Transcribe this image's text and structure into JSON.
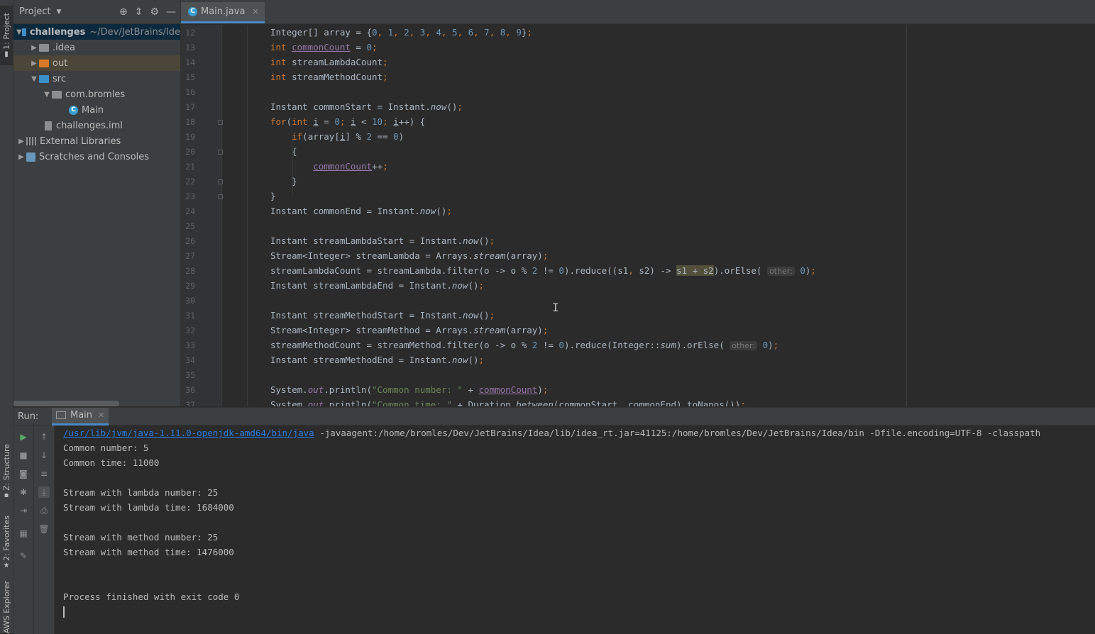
{
  "left_strip": {
    "project_tab": "1: Project",
    "structure_tab": "Z: Structure",
    "favorites_tab": "2: Favorites",
    "aws_tab": "AWS Explorer"
  },
  "project_panel": {
    "title": "Project",
    "tree": [
      {
        "label": "challenges",
        "path": "~/Dev/JetBrains/Ide"
      },
      {
        "label": ".idea"
      },
      {
        "label": "out"
      },
      {
        "label": "src"
      },
      {
        "label": "com.bromles"
      },
      {
        "label": "Main"
      },
      {
        "label": "challenges.iml"
      },
      {
        "label": "External Libraries"
      },
      {
        "label": "Scratches and Consoles"
      }
    ]
  },
  "editor": {
    "tab": "Main.java",
    "line_numbers": [
      "12",
      "13",
      "14",
      "15",
      "16",
      "17",
      "18",
      "19",
      "20",
      "21",
      "22",
      "23",
      "24",
      "25",
      "26",
      "27",
      "28",
      "29",
      "30",
      "31",
      "32",
      "33",
      "34",
      "35",
      "36",
      "37"
    ],
    "hint_other": "other:"
  },
  "run_panel": {
    "label": "Run:",
    "tab": "Main",
    "command_link": "/usr/lib/jvm/java-1.11.0-openjdk-amd64/bin/java",
    "command_args": " -javaagent:/home/bromles/Dev/JetBrains/Idea/lib/idea_rt.jar=41125:/home/bromles/Dev/JetBrains/Idea/bin -Dfile.encoding=UTF-8 -classpath",
    "output": [
      "Common number: 5",
      "Common time: 11000",
      "",
      "Stream with lambda number: 25",
      "Stream with lambda time: 1684000",
      "",
      "Stream with method number: 25",
      "Stream with method time: 1476000",
      "",
      "",
      "Process finished with exit code 0"
    ]
  }
}
